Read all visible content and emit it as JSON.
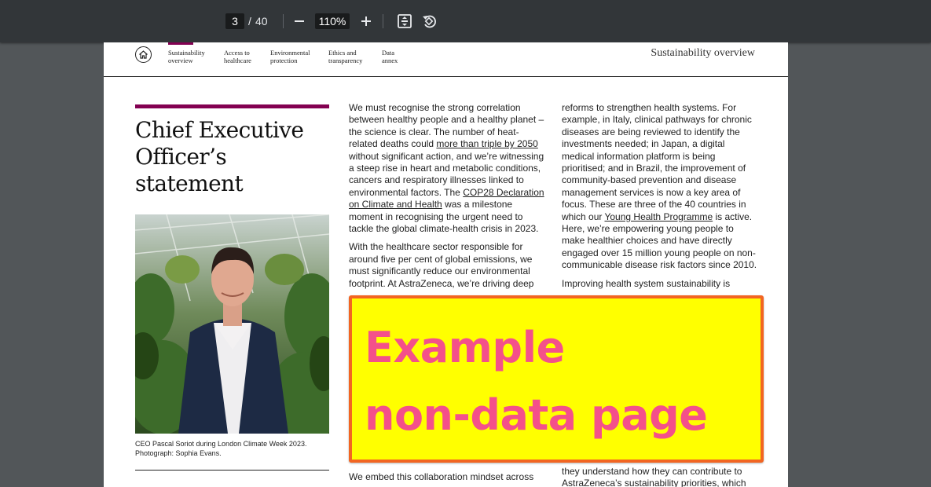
{
  "toolbar": {
    "current_page": "3",
    "page_separator": "/",
    "total_pages": "40",
    "zoom": "110%",
    "icons": [
      "zoom-out-icon",
      "zoom-in-icon",
      "fit-page-icon",
      "rotate-icon"
    ]
  },
  "document": {
    "nav": [
      {
        "label": "Sustainability\noverview"
      },
      {
        "label": "Access to\nhealthcare"
      },
      {
        "label": "Environmental\nprotection"
      },
      {
        "label": "Ethics and\ntransparency"
      },
      {
        "label": "Data\nannex"
      }
    ],
    "section_title": "Sustainability overview",
    "title": "Chief Executive Officer’s statement",
    "caption": "CEO Pascal Soriot during London Climate Week 2023. Photograph: Sophia Evans.",
    "col1": {
      "p1_a": "We must recognise the strong correlation between healthy people and a healthy planet – the science is clear. The number of heat-related deaths could ",
      "p1_link1": "more than triple by 2050",
      "p1_b": " without significant action, and we’re witnessing a steep rise in heart and metabolic conditions, cancers and respiratory illnesses linked to environmental factors. The ",
      "p1_link2": "COP28 Declaration",
      "p1_c": " ",
      "p1_link3": "on Climate and Health",
      "p1_d": " was a milestone moment in recognising the urgent need to tackle the global climate-health crisis in 2023.",
      "p2": "With the healthcare sector responsible for around five per cent of global emissions, we must significantly reduce our environmental footprint. At AstraZeneca, we’re driving deep",
      "bottom": "We embed this collaboration mindset across"
    },
    "col2": {
      "p1_a": "reforms to strengthen health systems. For example, in Italy, clinical pathways for chronic diseases are being reviewed to identify the investments needed; in Japan, a digital medical information platform is being prioritised; and in Brazil, the improvement of community-based prevention and disease management services is now a key area of focus. These are three of the 40 countries in which our ",
      "p1_link": "Young Health Programme",
      "p1_b": " is active. Here, we’re empowering young people to make healthier choices and have directly engaged over 15 million young people on non-communicable disease risk factors since 2010.",
      "p2": "Improving health system sustainability is",
      "bottom": "they understand how they can contribute to AstraZeneca’s sustainability priorities, which fills"
    }
  },
  "overlay": {
    "text": "Example\nnon-data page"
  }
}
